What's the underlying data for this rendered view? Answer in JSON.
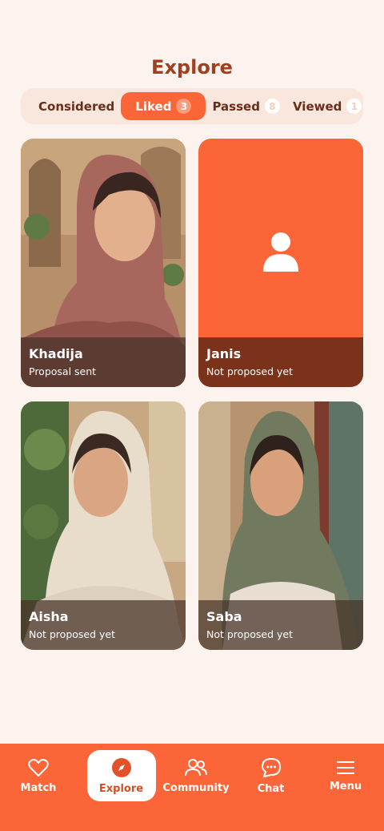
{
  "page": {
    "title": "Explore"
  },
  "tabs": [
    {
      "label": "Considered",
      "count": ""
    },
    {
      "label": "Liked",
      "count": "3"
    },
    {
      "label": "Passed",
      "count": "8"
    },
    {
      "label": "Viewed",
      "count": "1"
    }
  ],
  "cards": [
    {
      "name": "Khadija",
      "status": "Proposal sent",
      "scarf_color": "#a8675c"
    },
    {
      "name": "Janis",
      "status": "Not proposed yet",
      "scarf_color": "#fc6537"
    },
    {
      "name": "Aisha",
      "status": "Not proposed yet",
      "scarf_color": "#e8dccb"
    },
    {
      "name": "Saba",
      "status": "Not proposed yet",
      "scarf_color": "#717a5e"
    }
  ],
  "nav": [
    {
      "label": "Match",
      "icon": "heart-icon"
    },
    {
      "label": "Explore",
      "icon": "compass-icon"
    },
    {
      "label": "Community",
      "icon": "people-icon"
    },
    {
      "label": "Chat",
      "icon": "chat-icon"
    },
    {
      "label": "Menu",
      "icon": "menu-icon"
    }
  ],
  "colors": {
    "accent": "#fc6537",
    "title": "#a0401f",
    "background": "#fdf3ee"
  }
}
